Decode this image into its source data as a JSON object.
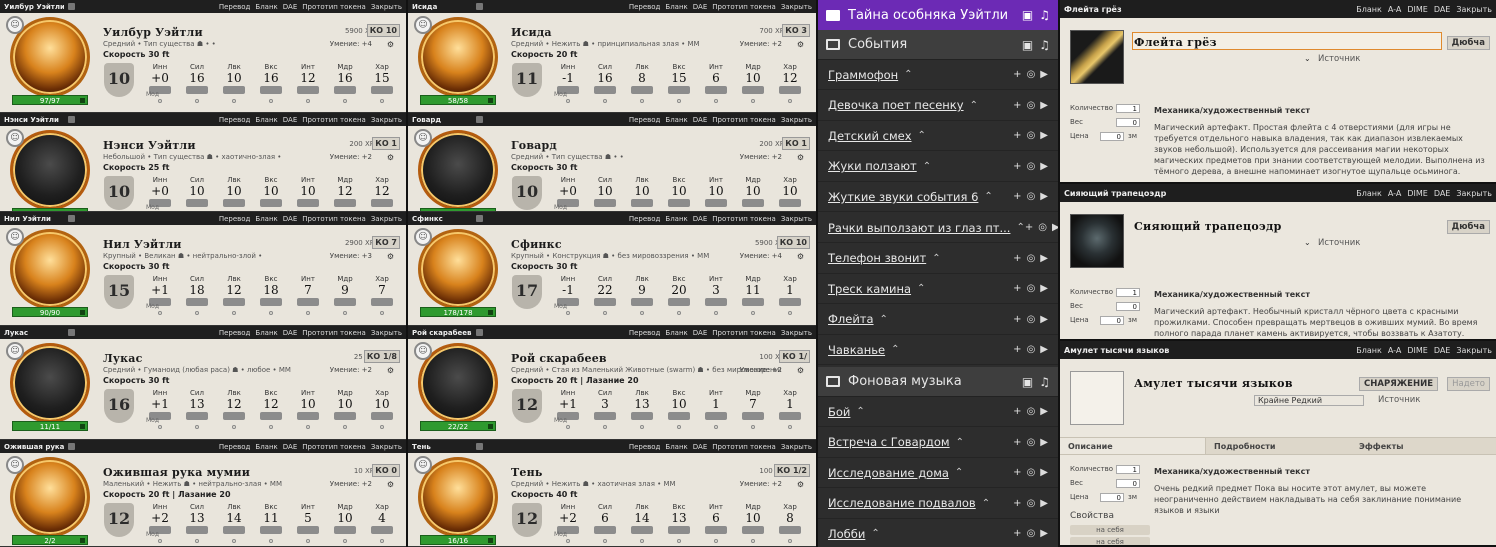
{
  "monster_cards_left": [
    {
      "window_name": "Уилбур Уэйтли",
      "name": "Уилбур Уэйтли",
      "sub": "Средний  •  Тип существа ☗  •  •",
      "speed": "Скорость 30 ft",
      "xp": "5900 XP",
      "ac": "КО 10",
      "skill": "Умение: +4",
      "hp": "97/97",
      "ac_shield": "10",
      "stats": [
        {
          "ab": "Инн",
          "val": "+0"
        },
        {
          "ab": "Сил",
          "val": "16"
        },
        {
          "ab": "Лвк",
          "val": "10"
        },
        {
          "ab": "Вкс",
          "val": "16"
        },
        {
          "ab": "Инт",
          "val": "12"
        },
        {
          "ab": "Мдр",
          "val": "16"
        },
        {
          "ab": "Хар",
          "val": "15"
        }
      ]
    },
    {
      "window_name": "Нэнси Уэйтли",
      "name": "Нэнси Уэйтли",
      "sub": "Небольшой  •  Тип существа ☗  •  хаотично-злая  •",
      "speed": "Скорость 25 ft",
      "xp": "200 XP",
      "ac": "КО 1",
      "skill": "Умение: +2",
      "hp": "21/21",
      "ac_shield": "10",
      "stats": [
        {
          "ab": "Инн",
          "val": "+0"
        },
        {
          "ab": "Сил",
          "val": "10"
        },
        {
          "ab": "Лвк",
          "val": "10"
        },
        {
          "ab": "Вкс",
          "val": "10"
        },
        {
          "ab": "Инт",
          "val": "10"
        },
        {
          "ab": "Мдр",
          "val": "12"
        },
        {
          "ab": "Хар",
          "val": "12"
        }
      ]
    },
    {
      "window_name": "Нил Уэйтли",
      "name": "Нил Уэйтли",
      "sub": "Крупный  •  Великан ☗  •  нейтрально-злой  •",
      "speed": "Скорость 30 ft",
      "xp": "2900 XP",
      "ac": "КО 7",
      "skill": "Умение: +3",
      "hp": "90/90",
      "ac_shield": "15",
      "stats": [
        {
          "ab": "Инн",
          "val": "+1"
        },
        {
          "ab": "Сил",
          "val": "18"
        },
        {
          "ab": "Лвк",
          "val": "12"
        },
        {
          "ab": "Вкс",
          "val": "18"
        },
        {
          "ab": "Инт",
          "val": "7"
        },
        {
          "ab": "Мдр",
          "val": "9"
        },
        {
          "ab": "Хар",
          "val": "7"
        }
      ]
    },
    {
      "window_name": "Лукас",
      "name": "Лукас",
      "sub": "Средний  •  Гуманоид (любая раса) ☗  •  любое  •  MM",
      "speed": "Скорость 30 ft",
      "xp": "25 XP",
      "ac": "КО 1/8",
      "skill": "Умение: +2",
      "hp": "11/11",
      "ac_shield": "16",
      "stats": [
        {
          "ab": "Инн",
          "val": "+1"
        },
        {
          "ab": "Сил",
          "val": "13"
        },
        {
          "ab": "Лвк",
          "val": "12"
        },
        {
          "ab": "Вкс",
          "val": "12"
        },
        {
          "ab": "Инт",
          "val": "10"
        },
        {
          "ab": "Мдр",
          "val": "10"
        },
        {
          "ab": "Хар",
          "val": "10"
        }
      ]
    },
    {
      "window_name": "Ожившая рука мумии",
      "name": "Ожившая рука мумии",
      "sub": "Маленький  •  Нежить ☗  •  нейтрально-злая  •  MM",
      "speed": "Скорость 20 ft | Лазание 20",
      "xp": "10 XP",
      "ac": "КО 0",
      "skill": "Умение: +2",
      "hp": "2/2",
      "ac_shield": "12",
      "stats": [
        {
          "ab": "Инн",
          "val": "+2"
        },
        {
          "ab": "Сил",
          "val": "13"
        },
        {
          "ab": "Лвк",
          "val": "14"
        },
        {
          "ab": "Вкс",
          "val": "11"
        },
        {
          "ab": "Инт",
          "val": "5"
        },
        {
          "ab": "Мдр",
          "val": "10"
        },
        {
          "ab": "Хар",
          "val": "4"
        }
      ]
    }
  ],
  "monster_cards_mid": [
    {
      "window_name": "Исида",
      "name": "Исида",
      "sub": "Средний  •  Нежить ☗  •  принципиальная злая  •  MM",
      "speed": "Скорость 20 ft",
      "xp": "700 XP",
      "ac": "КО 3",
      "skill": "Умение: +2",
      "hp": "58/58",
      "ac_shield": "11",
      "stats": [
        {
          "ab": "Инн",
          "val": "-1"
        },
        {
          "ab": "Сил",
          "val": "16"
        },
        {
          "ab": "Лвк",
          "val": "8"
        },
        {
          "ab": "Вкс",
          "val": "15"
        },
        {
          "ab": "Инт",
          "val": "6"
        },
        {
          "ab": "Мдр",
          "val": "10"
        },
        {
          "ab": "Хар",
          "val": "12"
        }
      ]
    },
    {
      "window_name": "Говард",
      "name": "Говард",
      "sub": "Средний  •  Тип существа ☗  •  •",
      "speed": "Скорость 30 ft",
      "xp": "200 XP",
      "ac": "КО 1",
      "skill": "Умение: +2",
      "hp": "10/10",
      "ac_shield": "10",
      "stats": [
        {
          "ab": "Инн",
          "val": "+0"
        },
        {
          "ab": "Сил",
          "val": "10"
        },
        {
          "ab": "Лвк",
          "val": "10"
        },
        {
          "ab": "Вкс",
          "val": "10"
        },
        {
          "ab": "Инт",
          "val": "10"
        },
        {
          "ab": "Мдр",
          "val": "10"
        },
        {
          "ab": "Хар",
          "val": "10"
        }
      ]
    },
    {
      "window_name": "Сфинкс",
      "name": "Сфинкс",
      "sub": "Крупный  •  Конструкция ☗  •  без мировоззрения  •  MM",
      "speed": "Скорость 30 ft",
      "xp": "5900 XP",
      "ac": "КО 10",
      "skill": "Умение: +4",
      "hp": "178/178",
      "ac_shield": "17",
      "stats": [
        {
          "ab": "Инн",
          "val": "-1"
        },
        {
          "ab": "Сил",
          "val": "22"
        },
        {
          "ab": "Лвк",
          "val": "9"
        },
        {
          "ab": "Вкс",
          "val": "20"
        },
        {
          "ab": "Инт",
          "val": "3"
        },
        {
          "ab": "Мдр",
          "val": "11"
        },
        {
          "ab": "Хар",
          "val": "1"
        }
      ]
    },
    {
      "window_name": "Рой скарабеев",
      "name": "Рой скарабеев",
      "sub": "Средний  •  Стая из Маленький Животные (swarm) ☗  •  без мировоззрения  •  MM",
      "speed": "Скорость 20 ft | Лазание 20",
      "xp": "100 XP",
      "ac": "КО 1/",
      "skill": "Умение: +2",
      "hp": "22/22",
      "ac_shield": "12",
      "stats": [
        {
          "ab": "Инн",
          "val": "+1"
        },
        {
          "ab": "Сил",
          "val": "3"
        },
        {
          "ab": "Лвк",
          "val": "13"
        },
        {
          "ab": "Вкс",
          "val": "10"
        },
        {
          "ab": "Инт",
          "val": "1"
        },
        {
          "ab": "Мдр",
          "val": "7"
        },
        {
          "ab": "Хар",
          "val": "1"
        }
      ]
    },
    {
      "window_name": "Тень",
      "name": "Тень",
      "sub": "Средний  •  Нежить ☗  •  хаотичная злая  •  MM",
      "speed": "Скорость 40 ft",
      "xp": "100 XP",
      "ac": "КО 1/2",
      "skill": "Умение: +2",
      "hp": "16/16",
      "ac_shield": "12",
      "stats": [
        {
          "ab": "Инн",
          "val": "+2"
        },
        {
          "ab": "Сил",
          "val": "6"
        },
        {
          "ab": "Лвк",
          "val": "14"
        },
        {
          "ab": "Вкс",
          "val": "13"
        },
        {
          "ab": "Инт",
          "val": "6"
        },
        {
          "ab": "Мдр",
          "val": "10"
        },
        {
          "ab": "Хар",
          "val": "8"
        }
      ]
    }
  ],
  "card_actions": [
    "Перевод",
    "Бланк",
    "DAE",
    "Прототип токена",
    "Закрыть"
  ],
  "mod_label": "Мод",
  "audio": {
    "playlist_title": "Тайна особняка Уэйтли",
    "folder1": "События",
    "items1": [
      "Граммофон",
      "Девочка поет песенку",
      "Детский смех",
      "Жуки ползают",
      "Жуткие звуки события 6",
      "Рачки выползают из глаз пт...",
      "Телефон звонит",
      "Треск камина",
      "Флейта",
      "Чавканье"
    ],
    "folder2": "Фоновая музыка",
    "items2": [
      "Бой",
      "Встреча с Говардом",
      "Исследование дома",
      "Исследование подвалов",
      "Лобби"
    ]
  },
  "items": [
    {
      "window_name": "Флейта грёз",
      "name": "Флейта грёз",
      "btn": "Дюбча",
      "source": "Источник",
      "qty_label": "Количество",
      "qty": "1",
      "weight_label": "Вес",
      "weight": "0",
      "price_label": "Цена",
      "price": "0",
      "currency": "зм",
      "mech_head": "Механика/художественный текст",
      "text": "Магический артефакт. Простая флейта с 4 отверстиями (для игры не требуется отдельного навыка владения, так как диапазон извлекаемых звуков небольшой). Используется для рассеивания магии некоторых магических предметов при знании соответствующей мелодии. Выполнена из тёмного дерева, а внешне напоминает изогнутое щупальце осьминога."
    },
    {
      "window_name": "Сияющий трапецоэдр",
      "name": "Сияющий трапецоэдр",
      "btn": "Дюбча",
      "source": "Источник",
      "qty_label": "Количество",
      "qty": "1",
      "weight_label": "Вес",
      "weight": "0",
      "price_label": "Цена",
      "price": "0",
      "currency": "зм",
      "mech_head": "Механика/художественный текст",
      "text": "Магический артефакт. Необычный кристалл чёрного цвета с красными прожилками. Способен превращать мертвецов в оживших мумий. Во время полного парада планет камень активируется, чтобы воззвать к Азатоту."
    },
    {
      "window_name": "Амулет тысячи языков",
      "name": "Амулет тысячи языков",
      "btn": "СНАРЯЖЕНИЕ",
      "btn2": "Надето",
      "rarity": "Крайне Редкий",
      "source": "Источник",
      "tabs": [
        "Описание",
        "Подробности",
        "Эффекты"
      ],
      "qty_label": "Количество",
      "qty": "1",
      "weight_label": "Вес",
      "weight": "0",
      "price_label": "Цена",
      "price": "0",
      "currency": "зм",
      "props": "Свойства",
      "prop1": "на себя",
      "prop2": "на себя",
      "mech_head": "Механика/художественный текст",
      "text": "Очень редкий предмет Пока вы носите этот амулет, вы можете неограниченно действием накладывать на себя заклинание понимание языков и языки"
    }
  ],
  "item_actions": [
    "Бланк",
    "A-A",
    "DIME",
    "DAE",
    "Закрыть"
  ],
  "colors": {
    "accent_purple": "#6c2ab5",
    "hp_green": "#2f9a2f",
    "parchment": "#e9e5dc"
  }
}
